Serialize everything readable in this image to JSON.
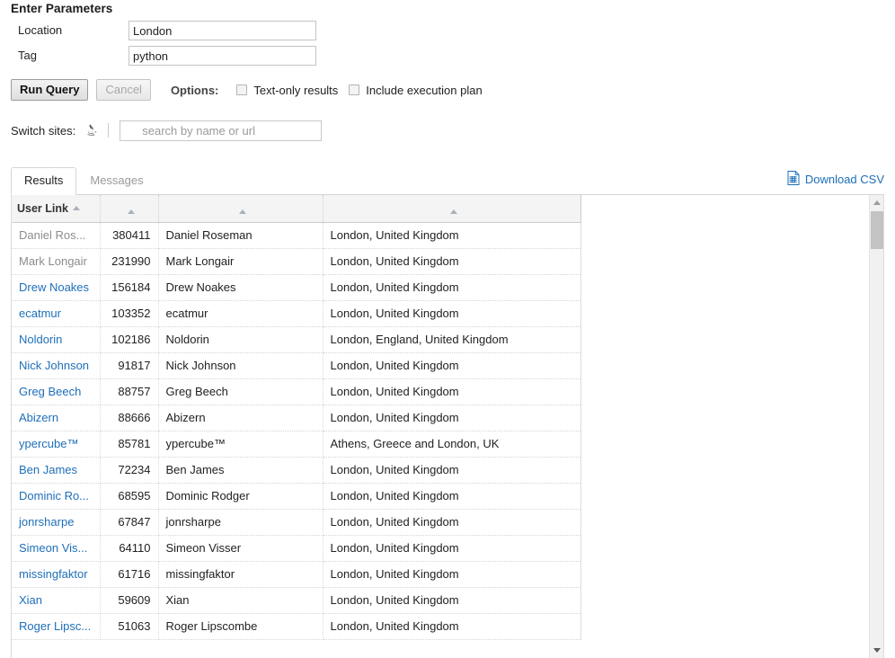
{
  "parameters": {
    "title": "Enter Parameters",
    "fields": [
      {
        "label": "Location",
        "value": "London",
        "placeholder": ""
      },
      {
        "label": "Tag",
        "value": "python",
        "placeholder": ""
      }
    ]
  },
  "actions": {
    "run_label": "Run Query",
    "cancel_label": "Cancel",
    "options_label": "Options:",
    "checkboxes": [
      {
        "label": "Text-only results",
        "checked": false
      },
      {
        "label": "Include execution plan",
        "checked": false
      }
    ]
  },
  "switch_sites": {
    "label": "Switch sites:",
    "icon": "java-site-icon",
    "search_placeholder": "search by name or url",
    "search_value": ""
  },
  "tabs": [
    {
      "label": "Results",
      "active": true
    },
    {
      "label": "Messages",
      "active": false
    }
  ],
  "download": {
    "label": "Download CSV",
    "icon": "csv-document-icon",
    "color": "#1d6fb8"
  },
  "grid": {
    "columns": [
      {
        "label": "User Link",
        "sortable": true,
        "align": "left"
      },
      {
        "label": "",
        "sortable": true,
        "align": "right"
      },
      {
        "label": "",
        "sortable": true,
        "align": "left"
      },
      {
        "label": "",
        "sortable": true,
        "align": "left"
      }
    ],
    "rows": [
      {
        "user_link": "Daniel Ros...",
        "visited": true,
        "id": "380411",
        "name": "Daniel Roseman",
        "location": "London, United Kingdom"
      },
      {
        "user_link": "Mark Longair",
        "visited": true,
        "id": "231990",
        "name": "Mark Longair",
        "location": "London, United Kingdom"
      },
      {
        "user_link": "Drew Noakes",
        "visited": false,
        "id": "156184",
        "name": "Drew Noakes",
        "location": "London, United Kingdom"
      },
      {
        "user_link": "ecatmur",
        "visited": false,
        "id": "103352",
        "name": "ecatmur",
        "location": "London, United Kingdom"
      },
      {
        "user_link": "Noldorin",
        "visited": false,
        "id": "102186",
        "name": "Noldorin",
        "location": "London, England, United Kingdom"
      },
      {
        "user_link": "Nick Johnson",
        "visited": false,
        "id": "91817",
        "name": "Nick Johnson",
        "location": "London, United Kingdom"
      },
      {
        "user_link": "Greg Beech",
        "visited": false,
        "id": "88757",
        "name": "Greg Beech",
        "location": "London, United Kingdom"
      },
      {
        "user_link": "Abizern",
        "visited": false,
        "id": "88666",
        "name": "Abizern",
        "location": "London, United Kingdom"
      },
      {
        "user_link": "ypercube™",
        "visited": false,
        "id": "85781",
        "name": "ypercube™",
        "location": "Athens, Greece and London, UK"
      },
      {
        "user_link": "Ben James",
        "visited": false,
        "id": "72234",
        "name": "Ben James",
        "location": "London, United Kingdom"
      },
      {
        "user_link": "Dominic Ro...",
        "visited": false,
        "id": "68595",
        "name": "Dominic Rodger",
        "location": "London, United Kingdom"
      },
      {
        "user_link": "jonrsharpe",
        "visited": false,
        "id": "67847",
        "name": "jonrsharpe",
        "location": "London, United Kingdom"
      },
      {
        "user_link": "Simeon Vis...",
        "visited": false,
        "id": "64110",
        "name": "Simeon Visser",
        "location": "London, United Kingdom"
      },
      {
        "user_link": "missingfaktor",
        "visited": false,
        "id": "61716",
        "name": "missingfaktor",
        "location": "London, United Kingdom"
      },
      {
        "user_link": "Xian",
        "visited": false,
        "id": "59609",
        "name": "Xian",
        "location": "London, United Kingdom"
      },
      {
        "user_link": "Roger Lipsc...",
        "visited": false,
        "id": "51063",
        "name": "Roger Lipscombe",
        "location": "London, United Kingdom"
      }
    ]
  },
  "scrollbar": {
    "up_icon": "chevron-up-icon",
    "down_icon": "chevron-down-icon",
    "thumb_position_pct": 3
  },
  "colors": {
    "link": "#1e6fb8",
    "visited_link": "#8c8c8c",
    "header_bg": "#f4f4f4"
  }
}
